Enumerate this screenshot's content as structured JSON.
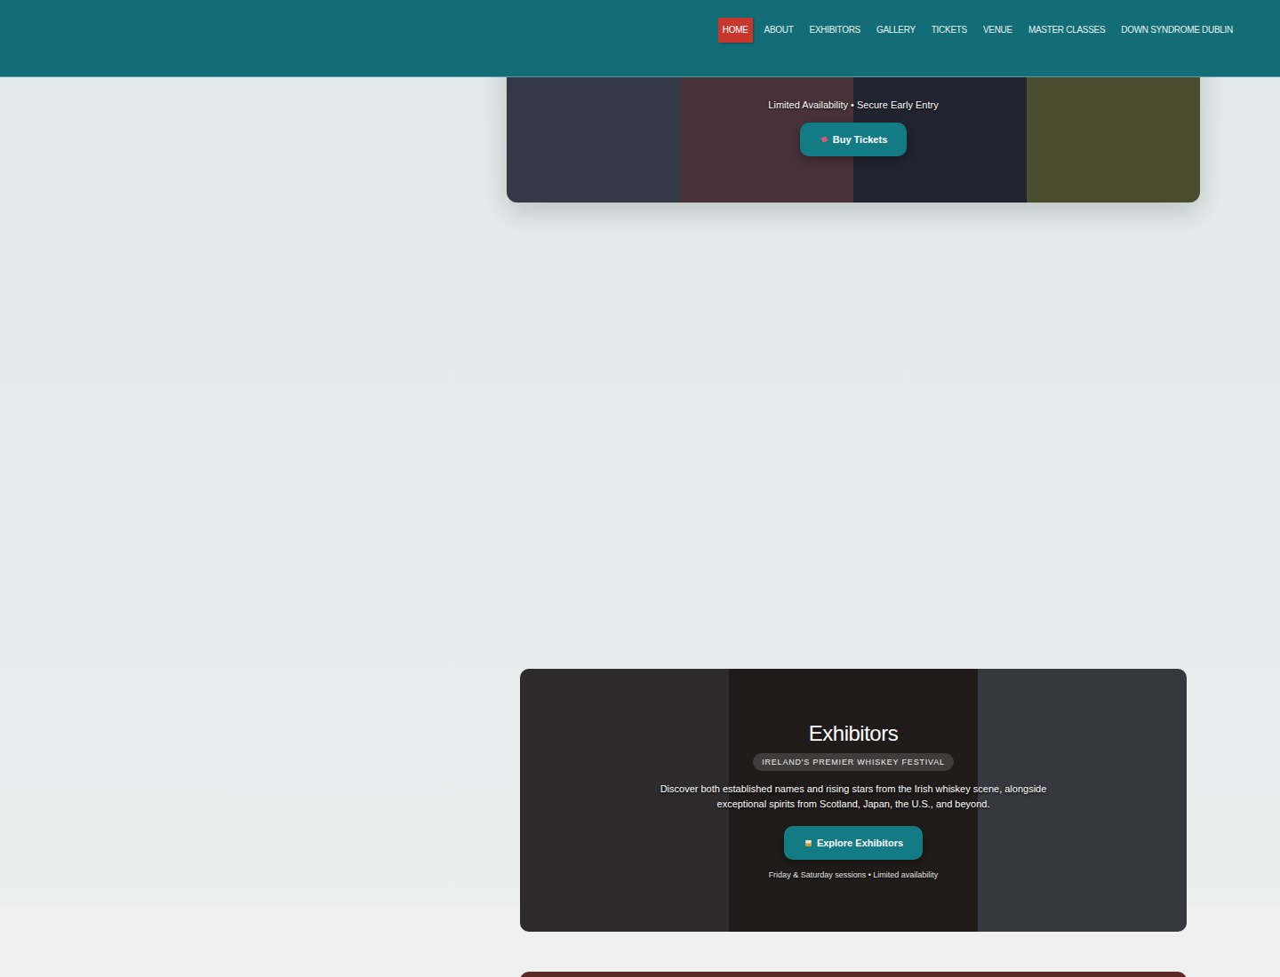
{
  "nav": {
    "items": [
      {
        "label": "HOME",
        "selected": true
      },
      {
        "label": "ABOUT",
        "selected": false
      },
      {
        "label": "EXHIBITORS",
        "selected": false
      },
      {
        "label": "GALLERY",
        "selected": false
      },
      {
        "label": "TICKETS",
        "selected": false
      },
      {
        "label": "VENUE",
        "selected": false
      },
      {
        "label": "MASTER CLASSES",
        "selected": false
      },
      {
        "label": "DOWN SYNDROME DUBLIN",
        "selected": false
      }
    ]
  },
  "hero": {
    "note": "Limited Availability • Secure Early Entry",
    "button": "Buy Tickets"
  },
  "exhibitors": {
    "title": "Exhibitors",
    "badge": "IRELAND'S PREMIER WHISKEY FESTIVAL",
    "description": "Discover both established names and rising stars from the Irish whiskey scene, alongside exceptional spirits from Scotland, Japan, the U.S., and beyond.",
    "button": "Explore Exhibitors",
    "note": "Friday & Saturday sessions • Limited availability"
  }
}
